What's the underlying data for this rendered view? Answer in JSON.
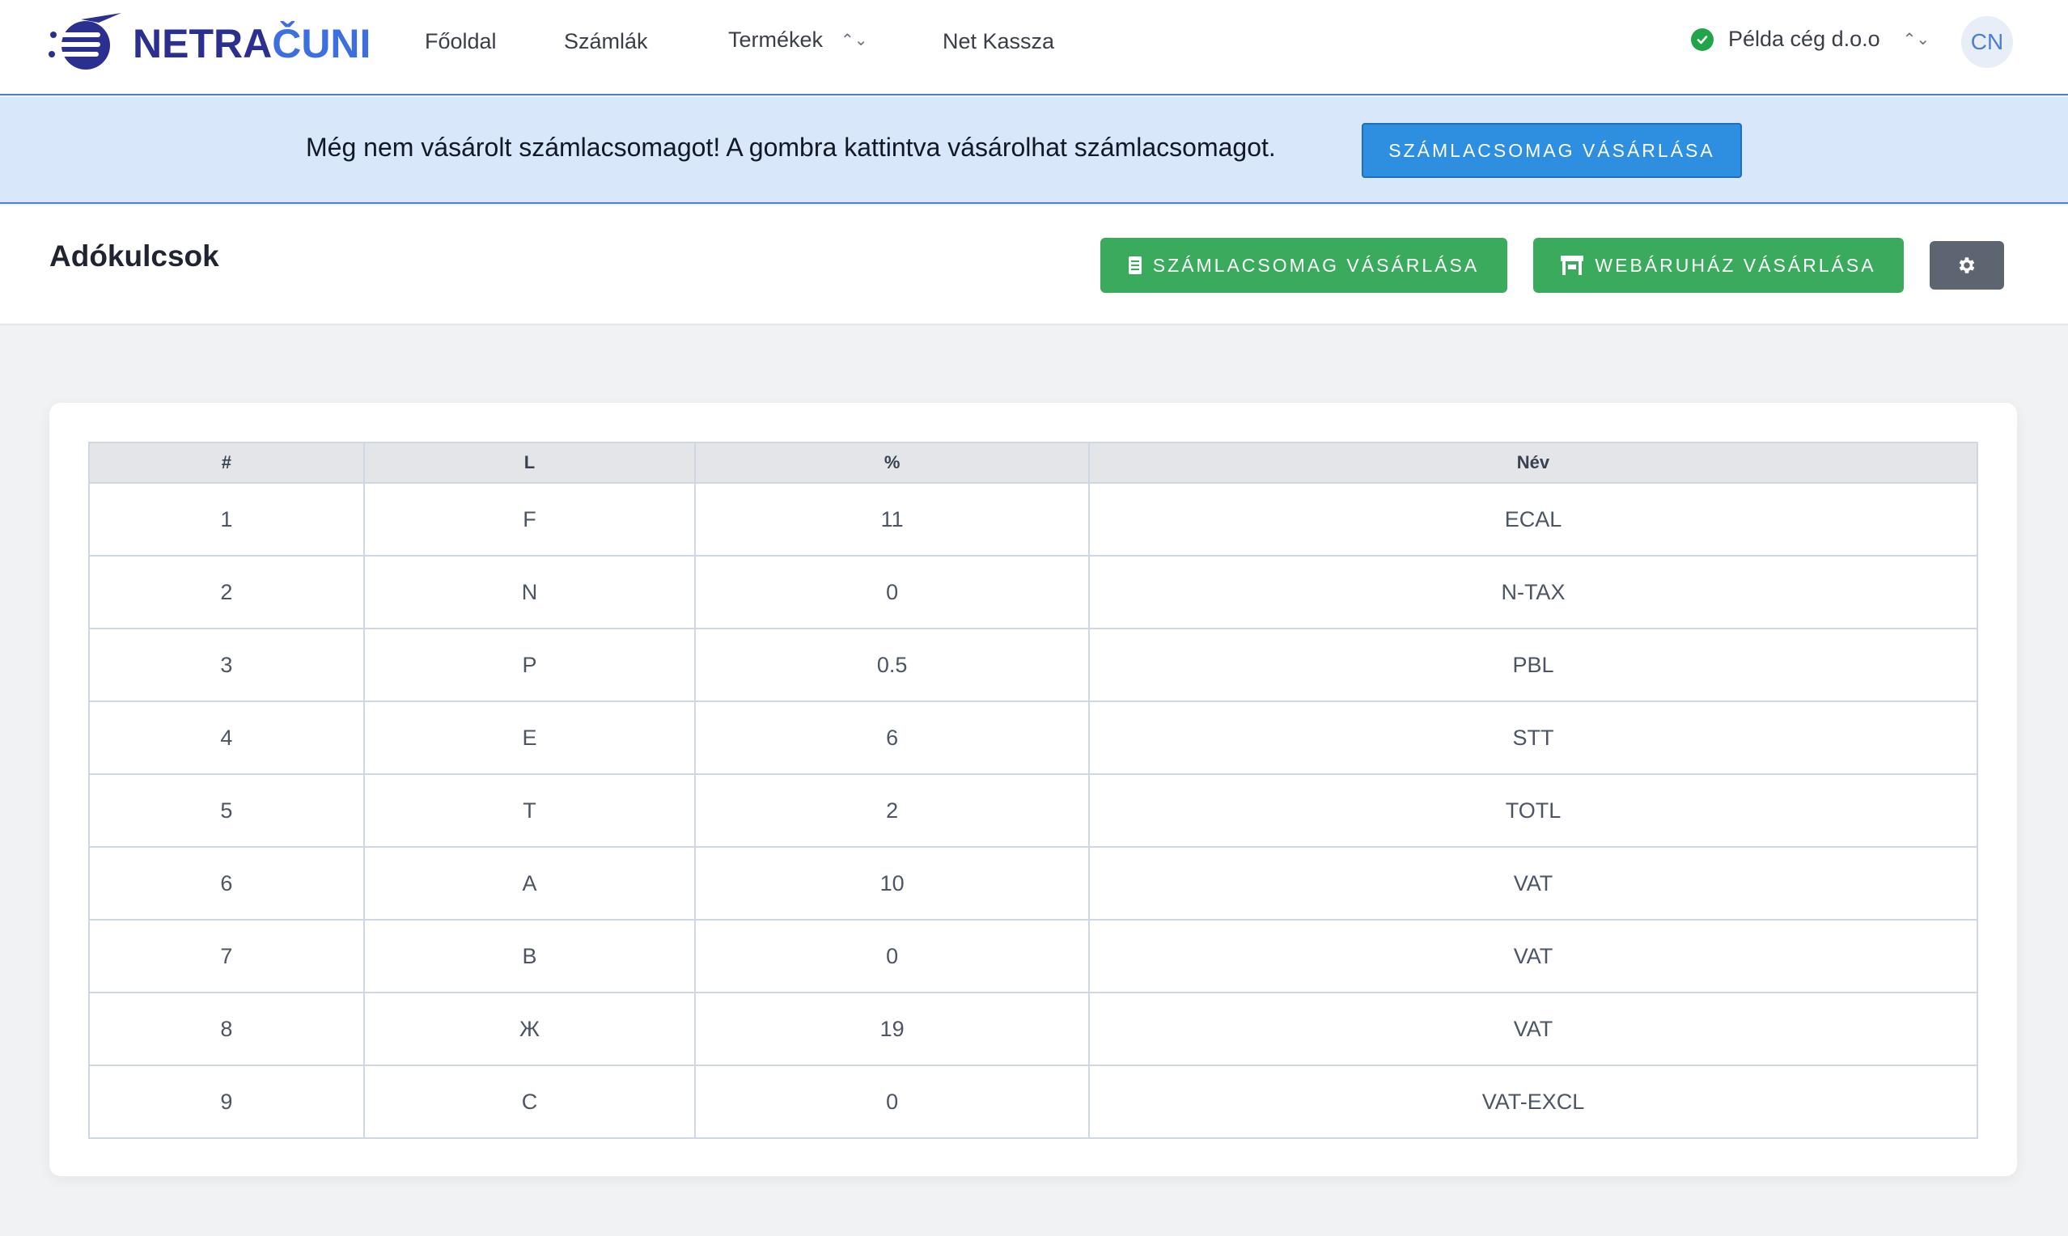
{
  "brand": {
    "logo_text_main": "NETRA",
    "logo_text_accent": "ČUNI"
  },
  "nav": {
    "items": [
      {
        "label": "Főoldal"
      },
      {
        "label": "Számlák"
      },
      {
        "label": "Termékek"
      },
      {
        "label": "Net Kassza"
      }
    ]
  },
  "company": {
    "name": "Példa cég d.o.o",
    "status_color": "#22a449"
  },
  "user": {
    "initials": "CN"
  },
  "banner": {
    "message": "Még nem vásárolt számlacsomagot! A gombra kattintva vásárolhat számlacsomagot.",
    "button_label": "SZÁMLACSOMAG VÁSÁRLÁSA"
  },
  "page": {
    "title": "Adókulcsok",
    "buy_package_label": "SZÁMLACSOMAG VÁSÁRLÁSA",
    "buy_webshop_label": "WEBÁRUHÁZ VÁSÁRLÁSA"
  },
  "table": {
    "headers": [
      "#",
      "L",
      "%",
      "Név"
    ],
    "rows": [
      [
        "1",
        "F",
        "11",
        "ECAL"
      ],
      [
        "2",
        "N",
        "0",
        "N-TAX"
      ],
      [
        "3",
        "P",
        "0.5",
        "PBL"
      ],
      [
        "4",
        "E",
        "6",
        "STT"
      ],
      [
        "5",
        "T",
        "2",
        "TOTL"
      ],
      [
        "6",
        "A",
        "10",
        "VAT"
      ],
      [
        "7",
        "B",
        "0",
        "VAT"
      ],
      [
        "8",
        "Ж",
        "19",
        "VAT"
      ],
      [
        "9",
        "C",
        "0",
        "VAT-EXCL"
      ]
    ]
  },
  "colors": {
    "accent": "#4a7fd4",
    "green": "#3aaa5c",
    "banner_bg": "#d9e7fa",
    "banner_button": "#2e8ee0"
  }
}
